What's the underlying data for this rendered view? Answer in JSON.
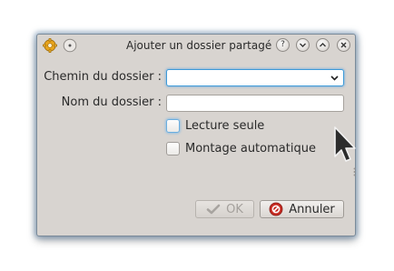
{
  "window": {
    "title": "Ajouter un dossier partagé",
    "titlebar_buttons": [
      "help",
      "minimize",
      "maximize",
      "close"
    ],
    "titlebar_button_glyphs": {
      "help": "?",
      "minimize": "⌄",
      "maximize": "⌃",
      "close": "×"
    }
  },
  "form": {
    "folder_path_label": "Chemin du dossier :",
    "folder_path_value": "",
    "folder_name_label": "Nom du dossier :",
    "folder_name_value": "",
    "read_only_label": "Lecture seule",
    "read_only_checked": false,
    "auto_mount_label": "Montage automatique",
    "auto_mount_checked": false
  },
  "buttons": {
    "ok_label": "OK",
    "ok_enabled": false,
    "cancel_label": "Annuler"
  },
  "colors": {
    "dialog_bg": "#d8d4d0",
    "focus_blue": "#3d9ad8",
    "cancel_icon_red": "#c62b22"
  },
  "icons": {
    "app_icon": "gear-icon",
    "menu_icon": "window-menu-icon",
    "ok_icon": "checkmark-icon",
    "cancel_icon": "cancel-icon",
    "combo_arrow": "chevron-down-icon",
    "pointer": "mouse-cursor-icon"
  }
}
